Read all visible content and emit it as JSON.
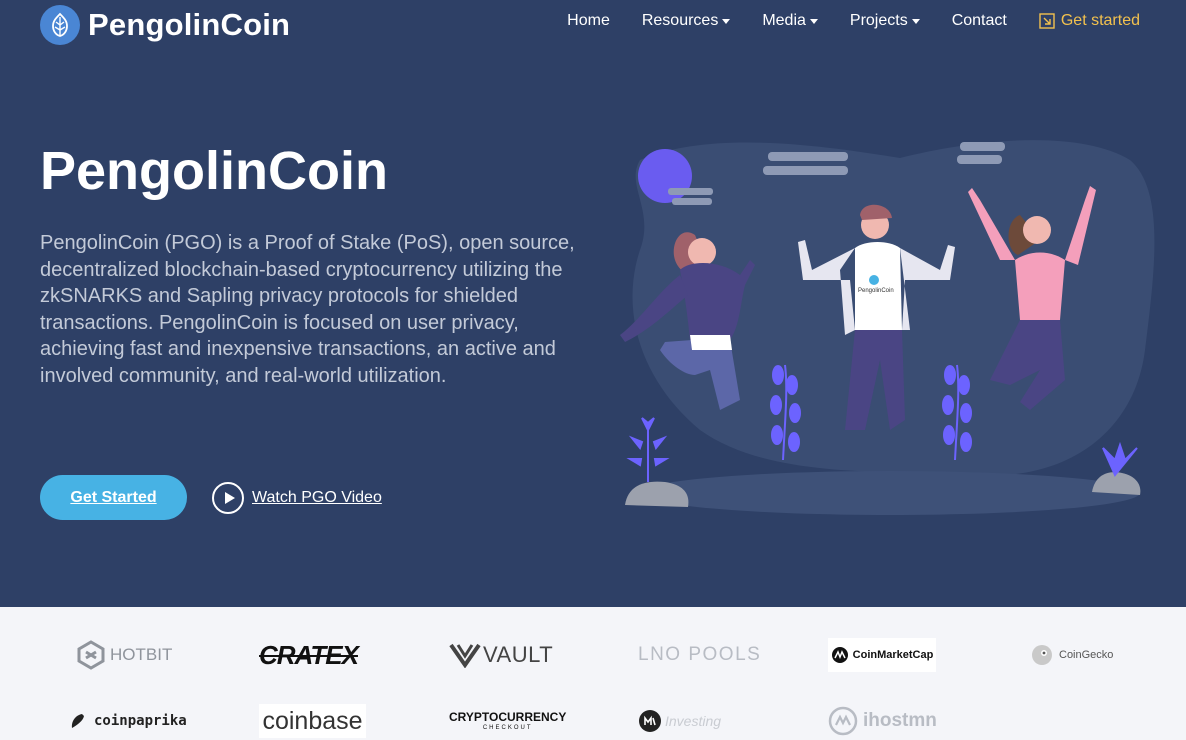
{
  "brand": {
    "name": "PengolinCoin",
    "logo_icon": "pangolin-leaf-icon"
  },
  "nav": {
    "items": [
      {
        "label": "Home",
        "dropdown": false
      },
      {
        "label": "Resources",
        "dropdown": true
      },
      {
        "label": "Media",
        "dropdown": true
      },
      {
        "label": "Projects",
        "dropdown": true
      },
      {
        "label": "Contact",
        "dropdown": false
      }
    ],
    "cta": {
      "label": "Get started",
      "icon": "enter-arrow-icon"
    }
  },
  "hero": {
    "title": "PengolinCoin",
    "description": "PengolinCoin (PGO) is a Proof of Stake (PoS), open source, decentralized blockchain-based cryptocurrency utilizing the zkSNARKS and Sapling privacy protocols for shielded transactions. PengolinCoin is focused on user privacy, achieving fast and inexpensive transactions, an active and involved community, and real-world utilization.",
    "primary_button": "Get Started",
    "video_link": "Watch PGO Video",
    "shirt_text": "PengolinCoin"
  },
  "partners": {
    "logos": [
      "HOTBIT",
      "CRATEX",
      "VAULT",
      "LNO POOLS",
      "CoinMarketCap",
      "CoinGecko",
      "coinpaprika",
      "coinbase",
      "CRYPTOCURRENCY",
      "CHECKOUT",
      "Investing",
      "ihostmn"
    ]
  },
  "colors": {
    "hero_bg": "#2e4066",
    "accent": "#47b2e4",
    "cta": "#f2c14e",
    "partners_bg": "#f4f5f9"
  }
}
